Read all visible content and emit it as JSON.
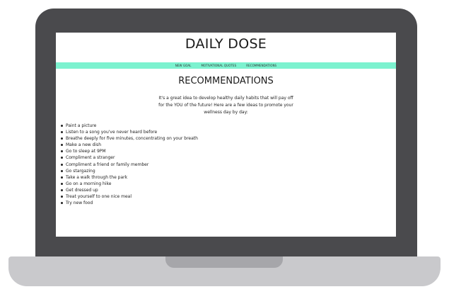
{
  "site": {
    "title": "DAILY DOSE"
  },
  "nav": {
    "items": [
      {
        "label": "NEW GOAL"
      },
      {
        "label": "MOTIVATIONAL QUOTES"
      },
      {
        "label": "RECOMMENDATIONS"
      }
    ]
  },
  "main": {
    "heading": "RECOMMENDATIONS",
    "intro": "It's a great idea to develop healthy daily habits that will pay off for the YOU of the future! Here are a few ideas to promote your wellness day by day:",
    "ideas": [
      "Paint a picture",
      "Listen to a song you've never heard before",
      "Breathe deeply for five minutes, concentrating on your breath",
      "Make a new dish",
      "Go to sleep at 9PM",
      "Compliment a stranger",
      "Compliment a friend or family member",
      "Go stargazing",
      "Take a walk through the park",
      "Go on a morning hike",
      "Get dressed up",
      "Treat yourself to one nice meal",
      "Try new food"
    ]
  },
  "colors": {
    "nav_bar": "#7cf2cf",
    "laptop_frame": "#4a4a4d",
    "laptop_base": "#c9c9cc"
  }
}
